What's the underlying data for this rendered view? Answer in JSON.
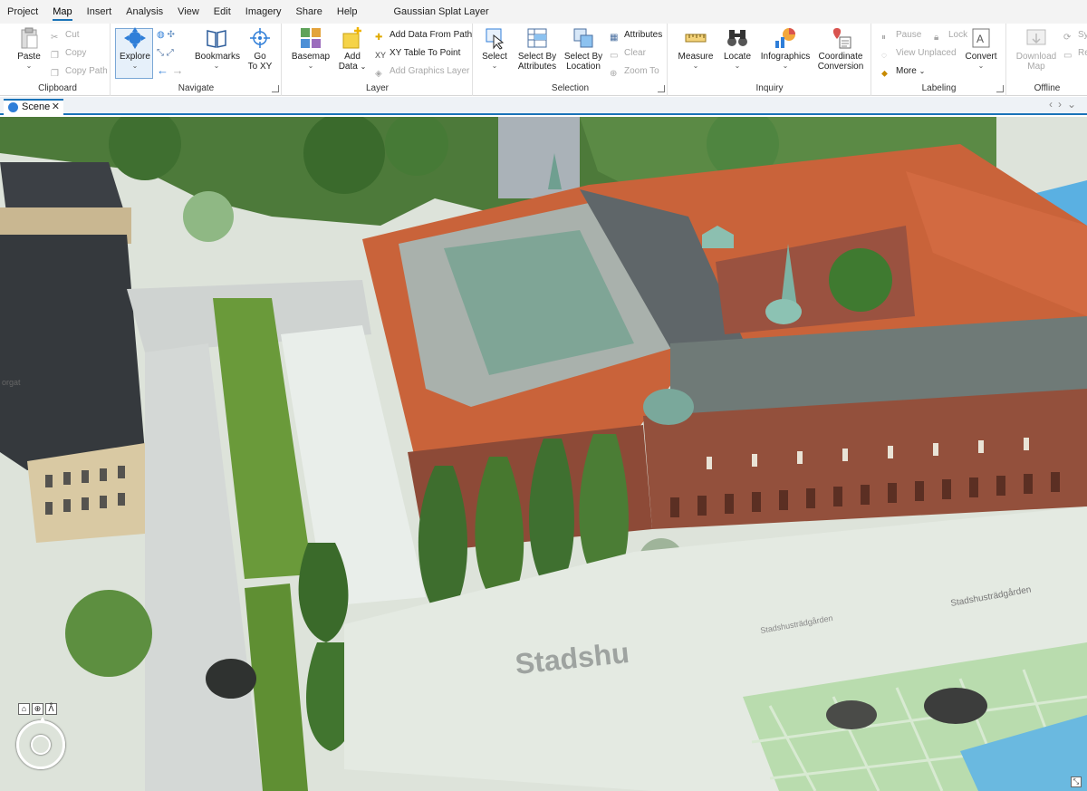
{
  "menu": {
    "tabs": [
      "Project",
      "Map",
      "Insert",
      "Analysis",
      "View",
      "Edit",
      "Imagery",
      "Share",
      "Help"
    ],
    "active_tab": "Map",
    "context_tab": "Gaussian Splat Layer"
  },
  "clipboard": {
    "label": "Clipboard",
    "paste": "Paste",
    "cut": "Cut",
    "copy": "Copy",
    "copy_path": "Copy Path"
  },
  "navigate": {
    "label": "Navigate",
    "explore": "Explore",
    "bookmarks": "Bookmarks",
    "go_to_xy_line1": "Go",
    "go_to_xy_line2": "To XY"
  },
  "layer": {
    "label": "Layer",
    "basemap": "Basemap",
    "add_data_line1": "Add",
    "add_data_line2": "Data",
    "add_data_from_path": "Add Data From Path",
    "xy_table_to_point": "XY Table To Point",
    "add_graphics_layer": "Add Graphics Layer"
  },
  "selection": {
    "label": "Selection",
    "select": "Select",
    "select_by_attributes_line1": "Select By",
    "select_by_attributes_line2": "Attributes",
    "select_by_location_line1": "Select By",
    "select_by_location_line2": "Location",
    "attributes": "Attributes",
    "clear": "Clear",
    "zoom_to": "Zoom To"
  },
  "inquiry": {
    "label": "Inquiry",
    "measure": "Measure",
    "locate": "Locate",
    "infographics": "Infographics",
    "coordinate_conversion_line1": "Coordinate",
    "coordinate_conversion_line2": "Conversion"
  },
  "labeling": {
    "label": "Labeling",
    "pause": "Pause",
    "lock": "Lock",
    "view_unplaced": "View Unplaced",
    "more": "More",
    "convert": "Convert"
  },
  "offline": {
    "label": "Offline",
    "download_map_line1": "Download",
    "download_map_line2": "Map",
    "sync": "Sy",
    "remove": "Re"
  },
  "document": {
    "tab": "Scene"
  },
  "map_labels": {
    "street_big": "Stadshu",
    "street_small": "Stadshusträdgården",
    "street_small2": "Stadshusträdgården",
    "corner_label": "orgat"
  },
  "colors": {
    "accent": "#1a73b8",
    "roof_copper": "#7fa596",
    "roof_tile": "#d1643d",
    "brick": "#93503c"
  }
}
